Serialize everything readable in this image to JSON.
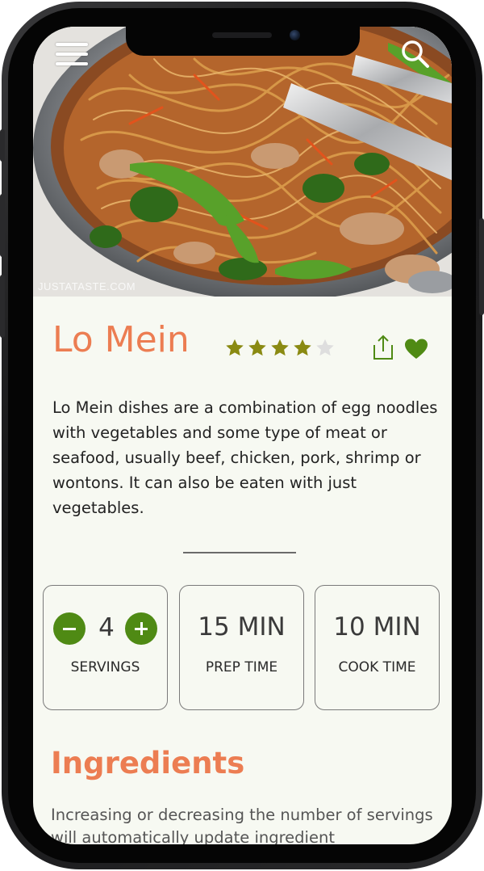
{
  "hero": {
    "watermark": "JUSTATASTE.COM",
    "menu_icon": "hamburger-menu-icon",
    "search_icon": "search-icon"
  },
  "recipe": {
    "title": "Lo Mein",
    "rating": 4,
    "rating_max": 5,
    "share_icon": "share-icon",
    "favorite_icon": "heart-icon",
    "description": "Lo Mein dishes are a combination of egg noodles with vegetables and some type of meat or seafood, usually beef, chicken, pork, shrimp or wontons. It can also be eaten with just vegetables."
  },
  "servings": {
    "value": "4",
    "label": "SERVINGS",
    "decrement_icon": "minus-icon",
    "increment_icon": "plus-icon"
  },
  "prep": {
    "value": "15 MIN",
    "label": "PREP TIME"
  },
  "cook": {
    "value": "10 MIN",
    "label": "COOK TIME"
  },
  "ingredients": {
    "title": "Ingredients",
    "note": "Increasing or decreasing the number of servings will automatically update ingredient"
  },
  "colors": {
    "accent": "#ec7d52",
    "star": "#8a8a12",
    "star_empty": "#dedede",
    "green": "#4f8a14",
    "background": "#f7f9f2"
  }
}
